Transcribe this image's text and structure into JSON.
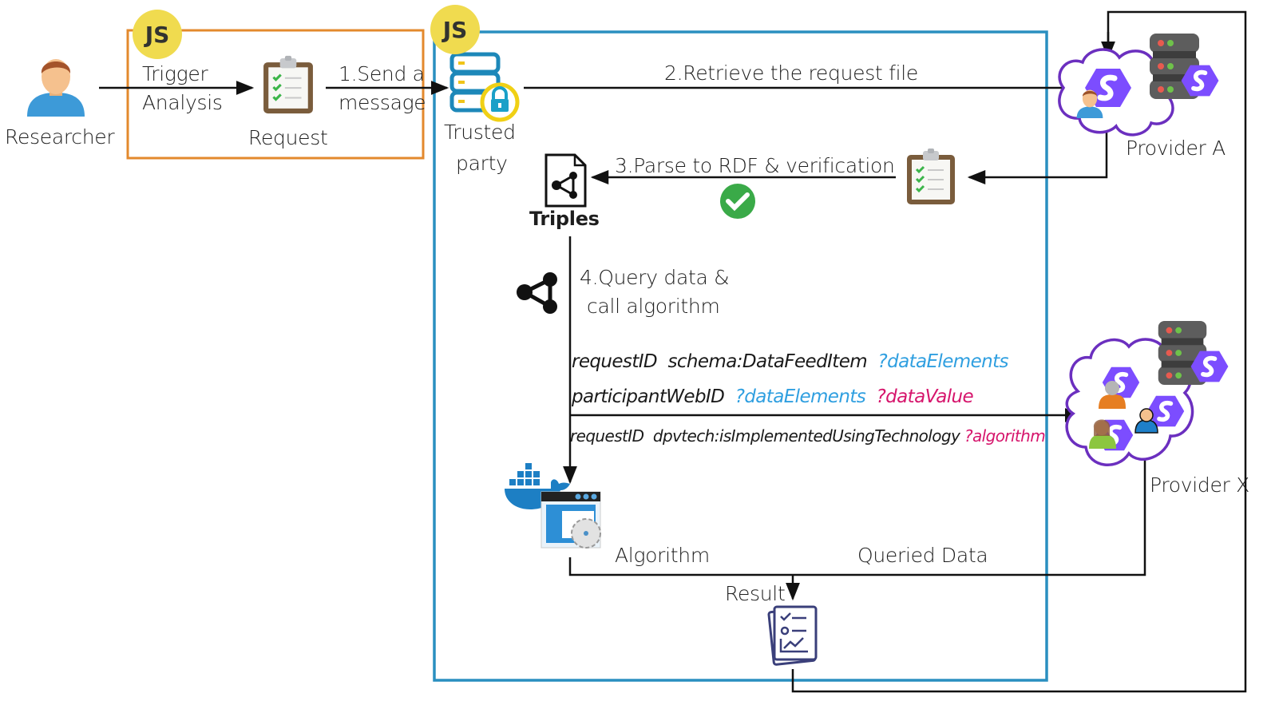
{
  "researcher": {
    "label": "Researcher"
  },
  "client_box": {
    "badge": "JS",
    "trigger_label_line1": "Trigger",
    "trigger_label_line2": "Analysis",
    "request_label": "Request",
    "accent_color": "#e3892d"
  },
  "trusted_party": {
    "badge": "JS",
    "label_line1": "Trusted",
    "label_line2": "party",
    "border_color": "#2a8fc0"
  },
  "steps": {
    "step1_line1": "1.Send a",
    "step1_line2": "message",
    "step2": "2.Retrieve the request file",
    "step3": "3.Parse to RDF & verification",
    "step4_line1": "4.Query data &",
    "step4_line2": "call algorithm"
  },
  "triples": {
    "label": "Triples"
  },
  "queries": [
    {
      "parts": [
        {
          "text": "requestID  schema:DataFeedItem  ",
          "color": "default"
        },
        {
          "text": "?dataElements",
          "color": "blue"
        }
      ]
    },
    {
      "parts": [
        {
          "text": "participantWebID  ",
          "color": "default"
        },
        {
          "text": "?dataElements",
          "color": "blue"
        },
        {
          "text": "  ",
          "color": "default"
        },
        {
          "text": "?dataValue",
          "color": "pink"
        }
      ]
    },
    {
      "parts": [
        {
          "text": "requestID  dpvtech:isImplementedUsingTechnology ",
          "color": "default"
        },
        {
          "text": "?algorithm",
          "color": "pink"
        }
      ]
    }
  ],
  "providers": {
    "a": {
      "label": "Provider A"
    },
    "x": {
      "label": "Provider X"
    }
  },
  "algorithm": {
    "label": "Algorithm"
  },
  "queried_data": {
    "label": "Queried Data"
  },
  "result": {
    "label": "Result"
  },
  "colors": {
    "query_blue": "#2f9fe0",
    "query_pink": "#d6156c",
    "solid_purple": "#7b4ae2",
    "check_green": "#3aaa48"
  }
}
